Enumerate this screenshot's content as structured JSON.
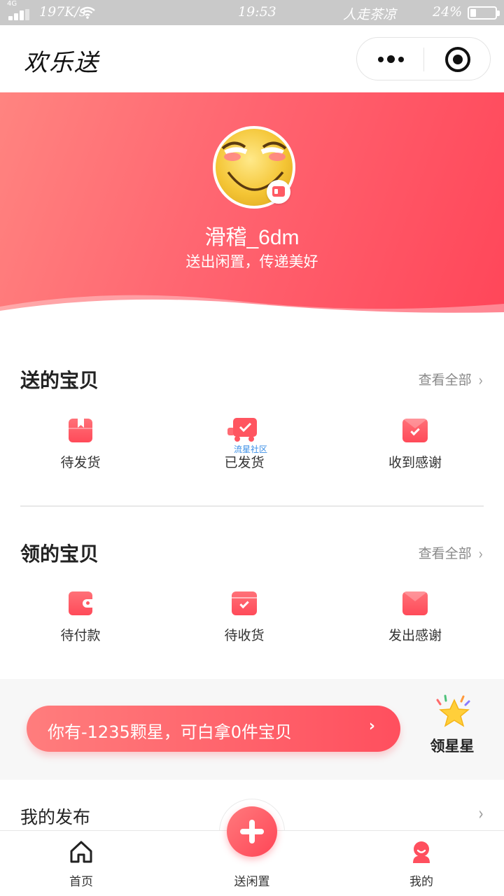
{
  "status_bar": {
    "network": "4G",
    "speed": "197K/s",
    "time": "19:53",
    "carrier": "人走茶凉",
    "battery": "24%",
    "battery_level": 0.24
  },
  "nav": {
    "title": "欢乐送"
  },
  "profile": {
    "username": "滑稽_6dm",
    "slogan": "送出闲置，传递美好"
  },
  "sent": {
    "title": "送的宝贝",
    "view_all": "查看全部",
    "items": [
      {
        "label": "待发货",
        "icon": "gift-box-icon"
      },
      {
        "label": "已发货",
        "icon": "delivery-truck-icon"
      },
      {
        "label": "收到感谢",
        "icon": "thanks-mail-icon"
      }
    ],
    "watermark": "流星社区"
  },
  "received": {
    "title": "领的宝贝",
    "view_all": "查看全部",
    "items": [
      {
        "label": "待付款",
        "icon": "wallet-icon"
      },
      {
        "label": "待收货",
        "icon": "receive-check-icon"
      },
      {
        "label": "发出感谢",
        "icon": "envelope-icon"
      }
    ]
  },
  "stars": {
    "text": "你有-1235颗星，可白拿0件宝贝",
    "arrow": "›",
    "get_label": "领星星"
  },
  "my_publish": {
    "label": "我的发布",
    "chevron": "›"
  },
  "tabs": [
    {
      "label": "首页",
      "icon": "home-icon"
    },
    {
      "label": "送闲置",
      "icon": "plus-icon"
    },
    {
      "label": "我的",
      "icon": "profile-icon"
    }
  ],
  "colors": {
    "accent": "#ff4f5e",
    "accent_light": "#ff7d7d",
    "text": "#222222",
    "muted": "#888888"
  }
}
